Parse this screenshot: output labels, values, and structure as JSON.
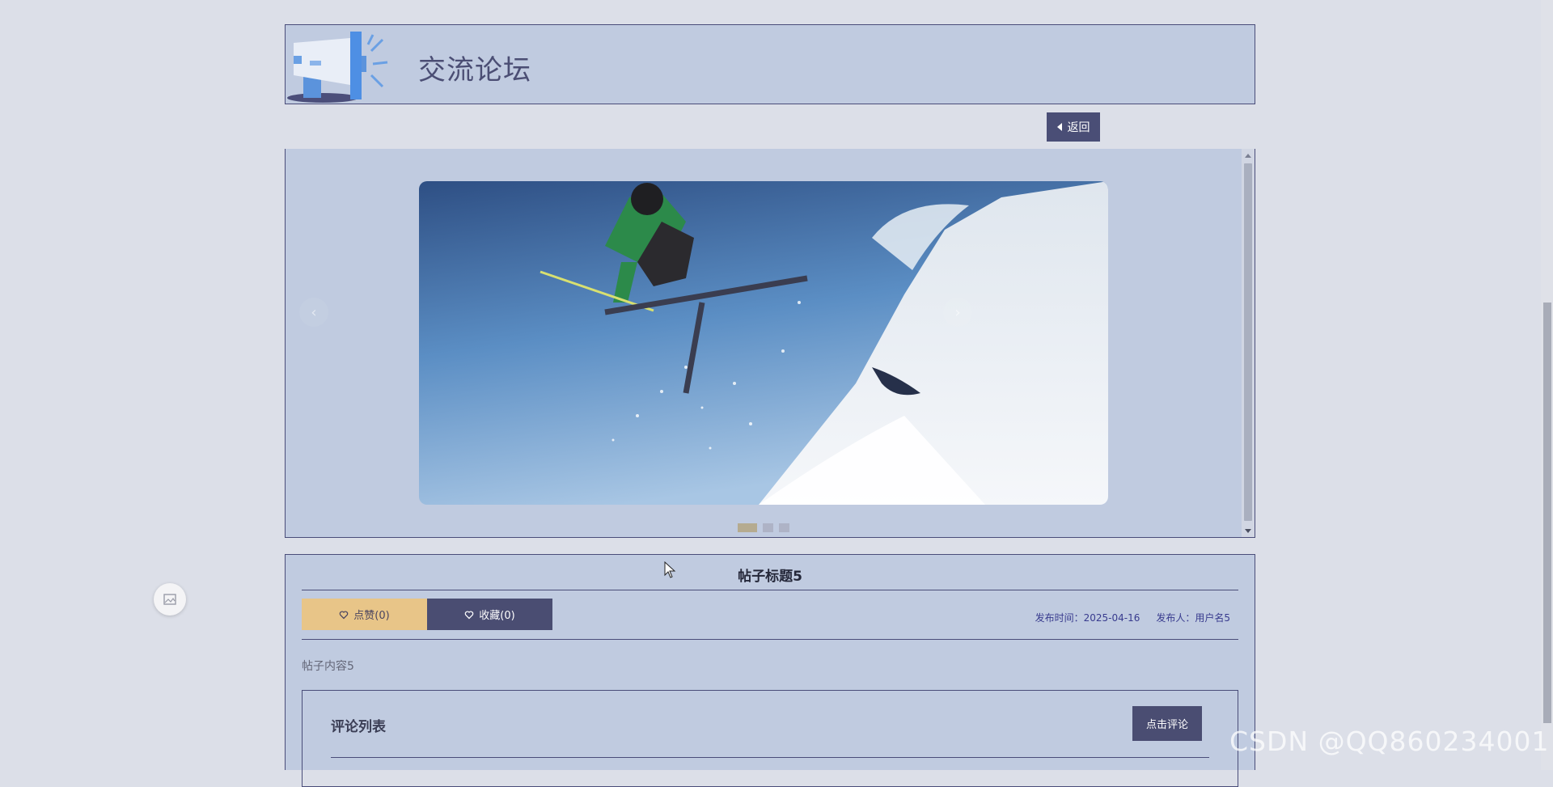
{
  "header": {
    "title": "交流论坛",
    "icon": "megaphone-icon"
  },
  "back_button": {
    "label": "返回",
    "icon": "caret-left-icon"
  },
  "carousel": {
    "prev_label": "‹",
    "next_label": "›",
    "slides": [
      "slide-1",
      "slide-2",
      "slide-3"
    ],
    "active_index": 0,
    "image_subject": "freestyle skier mid-air above snowy slope"
  },
  "post": {
    "title": "帖子标题5",
    "like_label": "点赞(0)",
    "favorite_label": "收藏(0)",
    "publish_time": "发布时间：2025-04-16",
    "publisher": "发布人：用户名5",
    "content": "帖子内容5"
  },
  "comments": {
    "title": "评论列表",
    "add_button": "点击评论"
  },
  "watermark": "CSDN @QQ860234001",
  "colors": {
    "background": "#dcdfe8",
    "panel": "#c0cbe0",
    "border": "#4a4d79",
    "dark_button": "#4a4d72",
    "like_button": "#e8c588",
    "meta_text": "#383b8e"
  }
}
